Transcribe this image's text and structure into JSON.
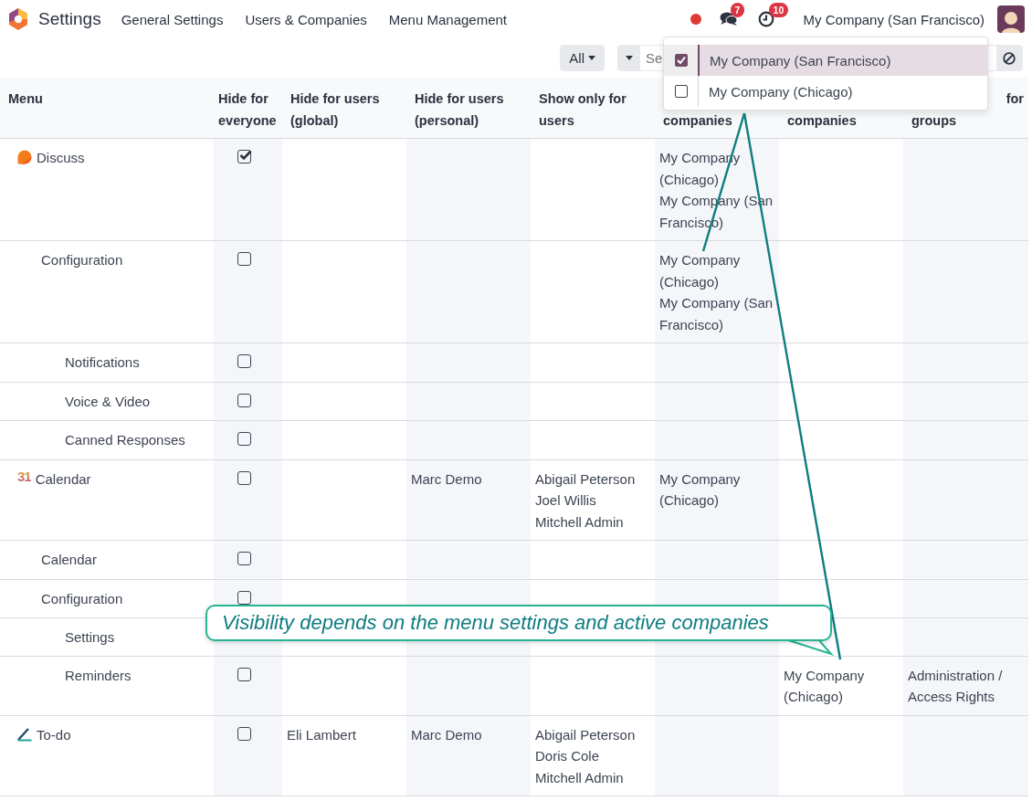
{
  "navbar": {
    "app_name": "Settings",
    "menu": [
      "General Settings",
      "Users & Companies",
      "Menu Management"
    ],
    "messages_badge": "7",
    "activities_badge": "10",
    "company": "My Company (San Francisco)"
  },
  "search": {
    "filter_button": "All",
    "placeholder": "Se"
  },
  "company_menu": {
    "items": [
      {
        "label": "My Company (San Francisco)",
        "checked": true,
        "selected": true
      },
      {
        "label": "My Company (Chicago)",
        "checked": false,
        "selected": false
      }
    ]
  },
  "table": {
    "columns": [
      {
        "lines": [
          "Menu"
        ],
        "kind": "full"
      },
      {
        "lines": [
          "Hide for",
          "everyone"
        ],
        "kind": "full"
      },
      {
        "lines": [
          "Hide for users",
          "(global)"
        ],
        "kind": "full"
      },
      {
        "lines": [
          "Hide for users",
          "(personal)"
        ],
        "kind": "full"
      },
      {
        "lines": [
          "Show only for",
          "users"
        ],
        "kind": "full"
      },
      {
        "lines": [
          "companies"
        ],
        "kind": "cut"
      },
      {
        "lines": [
          "companies"
        ],
        "kind": "cut"
      },
      {
        "lines": [
          "for",
          "groups"
        ],
        "kind": "cut"
      }
    ],
    "rows": [
      {
        "label": "Discuss",
        "icon": {
          "kind": "discuss"
        },
        "hidden": true,
        "column_6": [
          "My Company (Chicago)",
          "My Company (San Francisco)"
        ],
        "children": [
          {
            "label": "Configuration",
            "hidden": false,
            "column_6": [
              "My Company (Chicago)",
              "My Company (San Francisco)"
            ],
            "children": [
              {
                "label": "Notifications",
                "hidden": false
              },
              {
                "label": "Voice & Video",
                "hidden": false
              },
              {
                "label": "Canned Responses",
                "hidden": false
              }
            ]
          }
        ]
      },
      {
        "label": "Calendar",
        "icon": {
          "kind": "calendar",
          "text": "31"
        },
        "hidden": false,
        "hide_personal": [
          "Marc Demo"
        ],
        "show_users": [
          "Abigail Peterson",
          "Joel Willis",
          "Mitchell Admin"
        ],
        "column_6": [
          "My Company (Chicago)"
        ],
        "children": [
          {
            "label": "Calendar",
            "hidden": false
          },
          {
            "label": "Configuration",
            "hidden": false,
            "children": [
              {
                "label": "Settings"
              },
              {
                "label": "Reminders",
                "hidden": false,
                "column_7": [
                  "My Company (Chicago)"
                ],
                "column_8": [
                  "Administration / Access Rights"
                ]
              }
            ]
          }
        ]
      },
      {
        "label": "To-do",
        "icon": {
          "kind": "todo"
        },
        "hidden": false,
        "hide_global": [
          "Eli Lambert"
        ],
        "hide_personal": [
          "Marc Demo"
        ],
        "show_users": [
          "Abigail Peterson",
          "Doris Cole",
          "Mitchell Admin"
        ]
      }
    ]
  },
  "callout": {
    "text": "Visibility depends on the menu settings and active companies"
  }
}
